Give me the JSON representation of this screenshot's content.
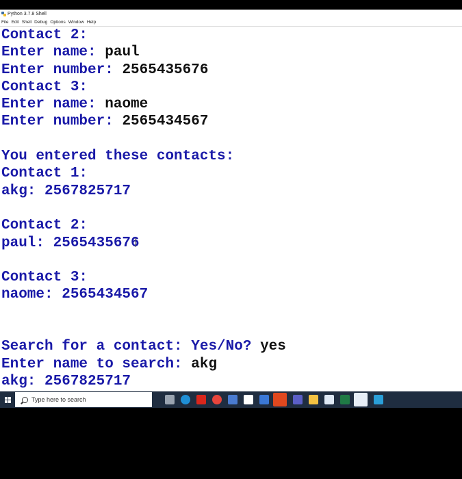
{
  "window": {
    "title": "Python 3.7.8 Shell",
    "menu": [
      "File",
      "Edit",
      "Shell",
      "Debug",
      "Options",
      "Window",
      "Help"
    ]
  },
  "shell_lines": [
    {
      "prompt": "Contact 2:",
      "input": ""
    },
    {
      "prompt": "Enter name: ",
      "input": "paul"
    },
    {
      "prompt": "Enter number: ",
      "input": "2565435676"
    },
    {
      "prompt": "Contact 3:",
      "input": ""
    },
    {
      "prompt": "Enter name: ",
      "input": "naome"
    },
    {
      "prompt": "Enter number: ",
      "input": "2565434567"
    },
    {
      "prompt": "",
      "input": ""
    },
    {
      "prompt": "You entered these contacts:",
      "input": ""
    },
    {
      "prompt": "Contact 1:",
      "input": ""
    },
    {
      "prompt": "akg: 2567825717",
      "input": ""
    },
    {
      "prompt": "",
      "input": ""
    },
    {
      "prompt": "Contact 2:",
      "input": ""
    },
    {
      "prompt": "paul: 2565435676",
      "input": ""
    },
    {
      "prompt": "",
      "input": ""
    },
    {
      "prompt": "Contact 3:",
      "input": ""
    },
    {
      "prompt": "naome: 2565434567",
      "input": ""
    },
    {
      "prompt": "",
      "input": ""
    },
    {
      "prompt": "",
      "input": ""
    },
    {
      "prompt": "Search for a contact: Yes/No? ",
      "input": "yes"
    },
    {
      "prompt": "Enter name to search: ",
      "input": "akg"
    },
    {
      "prompt": "akg: 2567825717",
      "input": ""
    }
  ],
  "taskbar": {
    "search_placeholder": "Type here to search",
    "icons": [
      {
        "name": "task-view-icon",
        "color": "#9aa4b1"
      },
      {
        "name": "edge-icon",
        "color": "#1f8fd6"
      },
      {
        "name": "acrobat-icon",
        "color": "#d9261c"
      },
      {
        "name": "chrome-icon",
        "color": "#e8453c"
      },
      {
        "name": "store-icon",
        "color": "#4a7bd0"
      },
      {
        "name": "calendar-icon",
        "color": "#ffffff"
      },
      {
        "name": "mail-icon",
        "color": "#3b78d6"
      },
      {
        "name": "office-icon",
        "color": "#e0481f"
      },
      {
        "name": "teams-icon",
        "color": "#5b5fc7"
      },
      {
        "name": "file-explorer-icon",
        "color": "#f5c242"
      },
      {
        "name": "box-icon",
        "color": "#dfe9f5"
      },
      {
        "name": "excel-icon",
        "color": "#1f7a45"
      },
      {
        "name": "notepad-icon",
        "color": "#e7eef7"
      },
      {
        "name": "photos-icon",
        "color": "#2a9fd8"
      }
    ]
  }
}
